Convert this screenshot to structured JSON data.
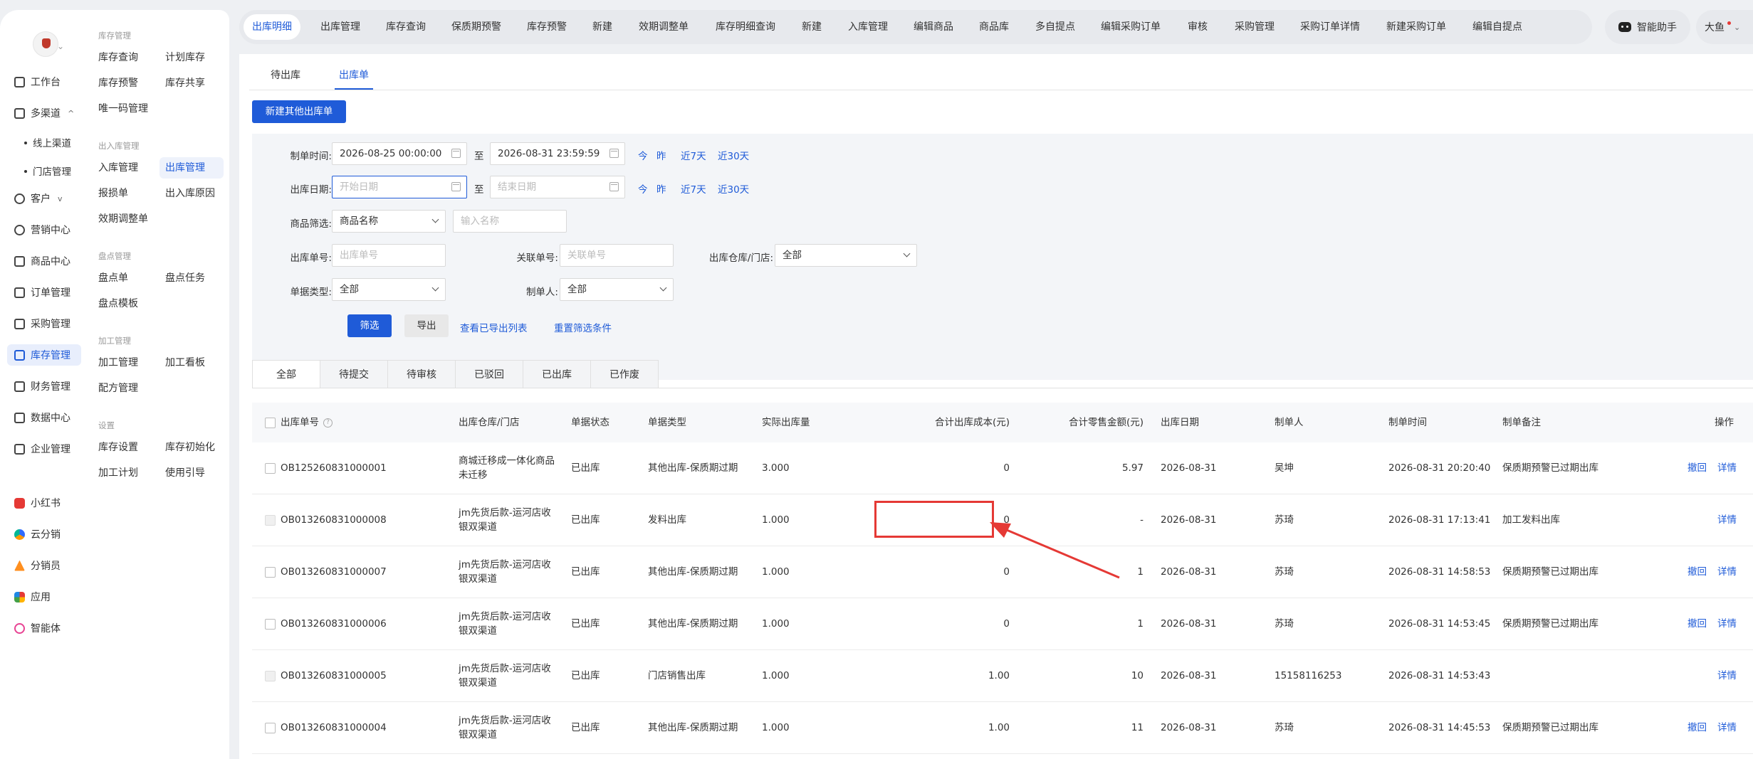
{
  "rail": {
    "items": [
      {
        "label": "工作台"
      },
      {
        "label": "多渠道",
        "caret": "^"
      },
      {
        "label": "线上渠道"
      },
      {
        "label": "门店管理"
      },
      {
        "label": "客户",
        "caret": "v"
      },
      {
        "label": "营销中心"
      },
      {
        "label": "商品中心"
      },
      {
        "label": "订单管理"
      },
      {
        "label": "采购管理"
      },
      {
        "label": "库存管理"
      },
      {
        "label": "财务管理"
      },
      {
        "label": "数据中心"
      },
      {
        "label": "企业管理"
      },
      {
        "label": "小红书"
      },
      {
        "label": "云分销"
      },
      {
        "label": "分销员"
      },
      {
        "label": "应用"
      },
      {
        "label": "智能体"
      }
    ]
  },
  "submenu": {
    "groups": [
      {
        "title": "库存管理"
      },
      {
        "title": "出入库管理"
      },
      {
        "title": "盘点管理"
      },
      {
        "title": "加工管理"
      },
      {
        "title": "设置"
      }
    ],
    "items": [
      "库存查询",
      "计划库存",
      "库存预警",
      "库存共享",
      "唯一码管理",
      "入库管理",
      "出库管理",
      "报损单",
      "出入库原因",
      "效期调整单",
      "盘点单",
      "盘点任务",
      "盘点模板",
      "加工管理",
      "加工看板",
      "配方管理",
      "库存设置",
      "库存初始化",
      "加工计划",
      "使用引导"
    ]
  },
  "topbar": {
    "tabs": [
      "出库明细",
      "出库管理",
      "库存查询",
      "保质期预警",
      "库存预警",
      "新建",
      "效期调整单",
      "库存明细查询",
      "新建",
      "入库管理",
      "编辑商品",
      "商品库",
      "多自提点",
      "编辑采购订单",
      "审核",
      "采购管理",
      "采购订单详情",
      "新建采购订单",
      "编辑自提点"
    ],
    "assistant": "智能助手",
    "user": "大鱼"
  },
  "page": {
    "tabs": [
      "待出库",
      "出库单"
    ],
    "new_button": "新建其他出库单"
  },
  "filters": {
    "create_time_label": "制单时间:",
    "create_time_start": "2026-08-25 00:00:00",
    "create_time_end": "2026-08-31 23:59:59",
    "to": "至",
    "quick": [
      "今",
      "昨",
      "近7天",
      "近30天"
    ],
    "out_date_label": "出库日期:",
    "out_date_start_ph": "开始日期",
    "out_date_end_ph": "结束日期",
    "product_filter_label": "商品筛选:",
    "product_filter_value": "商品名称",
    "product_name_ph": "输入名称",
    "order_no_label": "出库单号:",
    "order_no_ph": "出库单号",
    "related_no_label": "关联单号:",
    "related_no_ph": "关联单号",
    "warehouse_label": "出库仓库/门店:",
    "warehouse_value": "全部",
    "type_label": "单据类型:",
    "type_value": "全部",
    "creator_label": "制单人:",
    "creator_value": "全部",
    "filter_btn": "筛选",
    "export_btn": "导出",
    "view_export": "查看已导出列表",
    "reset": "重置筛选条件"
  },
  "status_tabs": [
    "全部",
    "待提交",
    "待审核",
    "已驳回",
    "已出库",
    "已作废"
  ],
  "table": {
    "headers": [
      "出库单号",
      "出库仓库/门店",
      "单据状态",
      "单据类型",
      "实际出库量",
      "合计出库成本(元)",
      "合计零售金额(元)",
      "出库日期",
      "制单人",
      "制单时间",
      "制单备注",
      "操作"
    ],
    "info_icon": "?",
    "rows": [
      {
        "no": "OB125260831000001",
        "wh": "商城迁移成一体化商品未迁移",
        "status": "已出库",
        "type": "其他出库-保质期过期",
        "qty": "3.000",
        "cost": "0",
        "retail": "5.97",
        "date": "2026-08-31",
        "creator": "吴坤",
        "time": "2026-08-31 20:20:40",
        "remark": "保质期预警已过期出库",
        "ops": [
          "撤回",
          "详情"
        ],
        "disabled": false
      },
      {
        "no": "OB013260831000008",
        "wh": "jm先货后款-运河店收银双渠道",
        "status": "已出库",
        "type": "发料出库",
        "qty": "1.000",
        "cost": "0",
        "retail": "-",
        "date": "2026-08-31",
        "creator": "苏琦",
        "time": "2026-08-31 17:13:41",
        "remark": "加工发料出库",
        "ops": [
          "详情"
        ],
        "disabled": true
      },
      {
        "no": "OB013260831000007",
        "wh": "jm先货后款-运河店收银双渠道",
        "status": "已出库",
        "type": "其他出库-保质期过期",
        "qty": "1.000",
        "cost": "0",
        "retail": "1",
        "date": "2026-08-31",
        "creator": "苏琦",
        "time": "2026-08-31 14:58:53",
        "remark": "保质期预警已过期出库",
        "ops": [
          "撤回",
          "详情"
        ],
        "disabled": false
      },
      {
        "no": "OB013260831000006",
        "wh": "jm先货后款-运河店收银双渠道",
        "status": "已出库",
        "type": "其他出库-保质期过期",
        "qty": "1.000",
        "cost": "0",
        "retail": "1",
        "date": "2026-08-31",
        "creator": "苏琦",
        "time": "2026-08-31 14:53:45",
        "remark": "保质期预警已过期出库",
        "ops": [
          "撤回",
          "详情"
        ],
        "disabled": false
      },
      {
        "no": "OB013260831000005",
        "wh": "jm先货后款-运河店收银双渠道",
        "status": "已出库",
        "type": "门店销售出库",
        "qty": "1.000",
        "cost": "1.00",
        "retail": "10",
        "date": "2026-08-31",
        "creator": "15158116253",
        "time": "2026-08-31 14:53:43",
        "remark": "",
        "ops": [
          "详情"
        ],
        "disabled": true
      },
      {
        "no": "OB013260831000004",
        "wh": "jm先货后款-运河店收银双渠道",
        "status": "已出库",
        "type": "其他出库-保质期过期",
        "qty": "1.000",
        "cost": "1.00",
        "retail": "11",
        "date": "2026-08-31",
        "creator": "苏琦",
        "time": "2026-08-31 14:45:53",
        "remark": "保质期预警已过期出库",
        "ops": [
          "撤回",
          "详情"
        ],
        "disabled": false
      }
    ]
  },
  "colors": {
    "accent": "#1f5bd8",
    "annotation": "#e53935"
  }
}
